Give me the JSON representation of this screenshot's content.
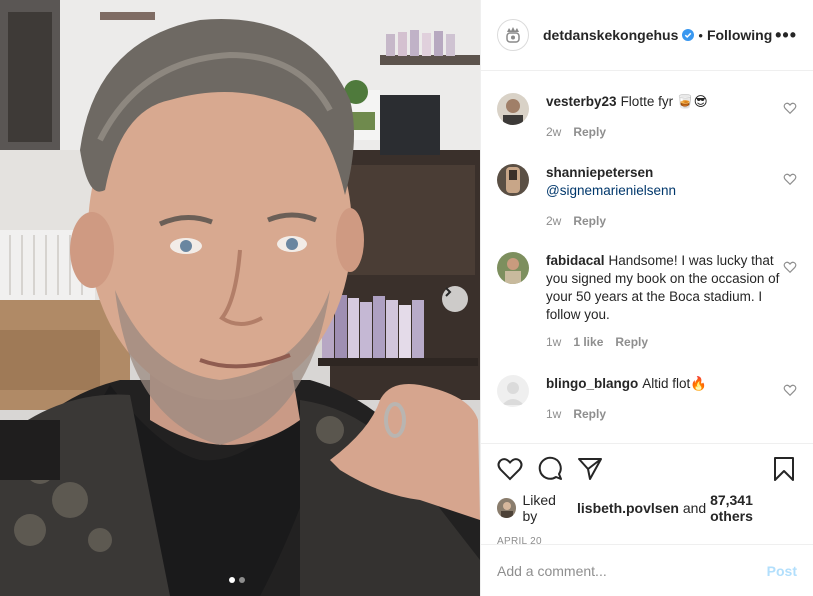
{
  "post": {
    "username": "detdanskekongehus",
    "verified": true,
    "separator": "•",
    "follow_status": "Following",
    "more_label": "•••",
    "carousel": {
      "slide_count": 2,
      "active_slide": 1
    }
  },
  "comments": [
    {
      "user": "vesterby23",
      "text": "Flotte fyr 🥃😎",
      "mention": "",
      "time": "2w",
      "likes": "",
      "reply": "Reply"
    },
    {
      "user": "shanniepetersen",
      "text": "",
      "mention": "@signemarienielsenn",
      "time": "2w",
      "likes": "",
      "reply": "Reply"
    },
    {
      "user": "fabidacal",
      "text": "Handsome! I was lucky that you signed my book on the occasion of your 50 years at the Boca stadium. I follow you.",
      "mention": "",
      "time": "1w",
      "likes": "1 like",
      "reply": "Reply"
    },
    {
      "user": "blingo_blango",
      "text": "Altid flot🔥",
      "mention": "",
      "time": "1w",
      "likes": "",
      "reply": "Reply"
    }
  ],
  "actions": {
    "liked_prefix": "Liked by",
    "liked_user": "lisbeth.povlsen",
    "liked_and": "and",
    "liked_others": "87,341 others",
    "date": "APRIL 20"
  },
  "add_comment": {
    "placeholder": "Add a comment...",
    "post_label": "Post"
  },
  "colors": {
    "verified_blue": "#3897f0",
    "post_button": "#b2dffc",
    "mention": "#00376b",
    "meta_gray": "#8e8e8e"
  },
  "icons": [
    "crown-logo-icon",
    "verified-icon",
    "more-icon",
    "heart-icon",
    "comment-icon",
    "share-icon",
    "bookmark-icon",
    "next-arrow-icon"
  ]
}
